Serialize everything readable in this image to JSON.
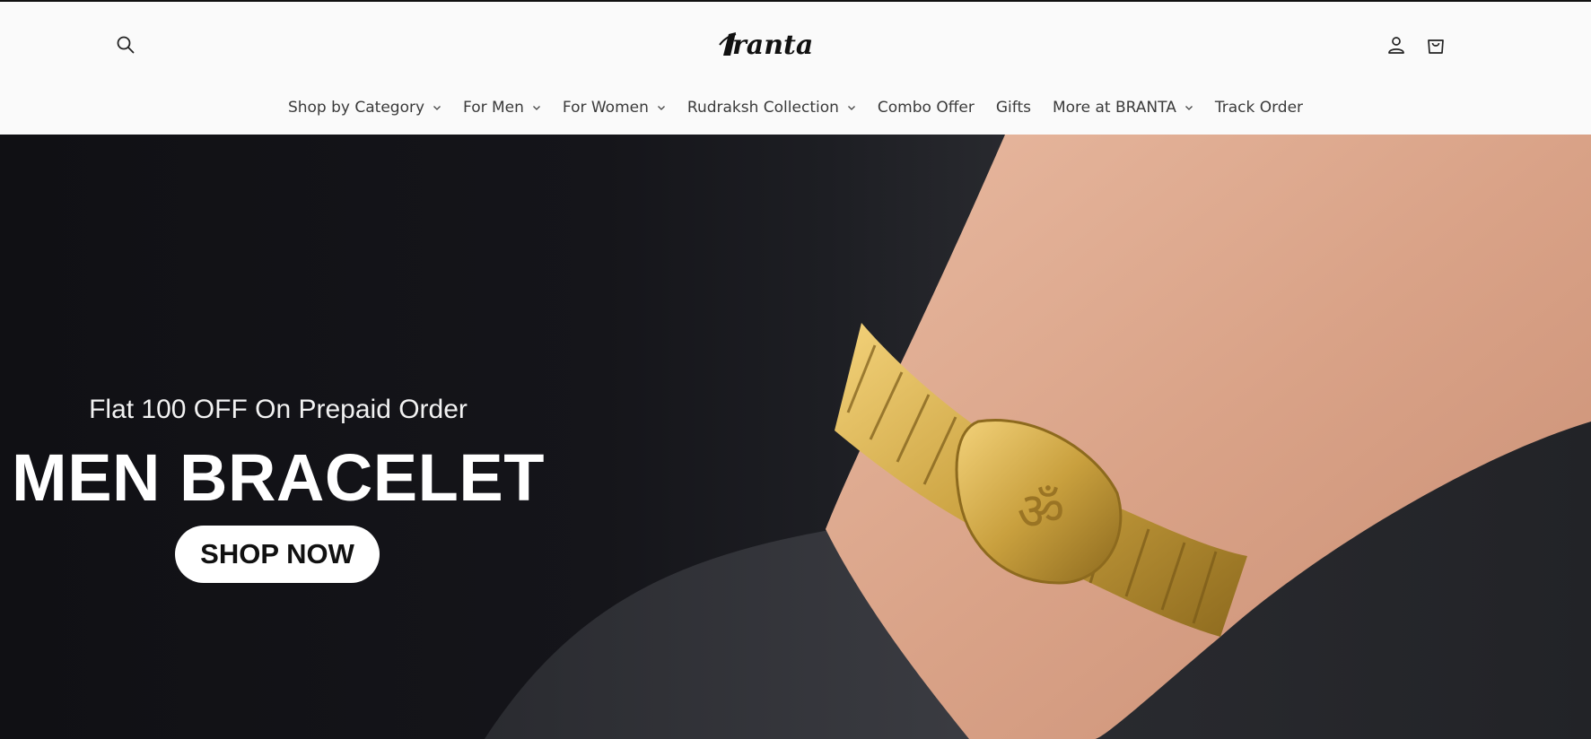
{
  "header": {
    "logo_text": "Branta",
    "icons": {
      "search": "search-icon",
      "account": "account-icon",
      "cart": "cart-icon"
    }
  },
  "nav": {
    "items": [
      {
        "label": "Shop by Category",
        "has_dropdown": true
      },
      {
        "label": "For Men",
        "has_dropdown": true
      },
      {
        "label": "For Women",
        "has_dropdown": true
      },
      {
        "label": "Rudraksh Collection",
        "has_dropdown": true
      },
      {
        "label": "Combo Offer",
        "has_dropdown": false
      },
      {
        "label": "Gifts",
        "has_dropdown": false
      },
      {
        "label": "More at BRANTA",
        "has_dropdown": true
      },
      {
        "label": "Track Order",
        "has_dropdown": false
      }
    ]
  },
  "hero": {
    "promo": "Flat 100 OFF On Prepaid Order",
    "title": "MEN BRACELET",
    "button_label": "SHOP NOW"
  },
  "colors": {
    "header_bg": "#fafafa",
    "nav_text": "#3a3a3a",
    "hero_bg": "#15151a",
    "gold": "#c9a03e"
  }
}
